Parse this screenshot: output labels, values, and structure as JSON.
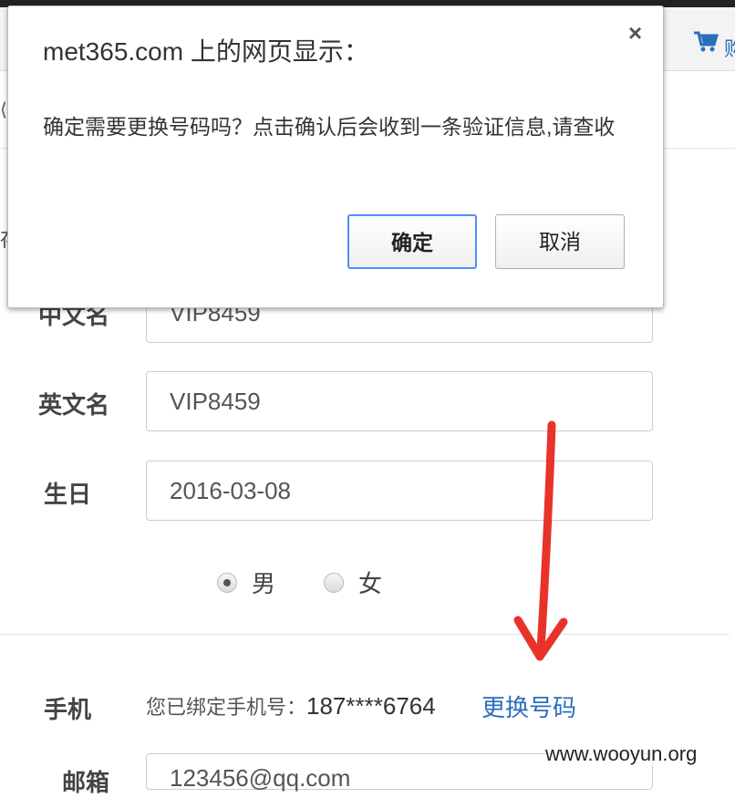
{
  "dialog": {
    "title": "met365.com 上的网页显示：",
    "message": "确定需要更换号码吗？点击确认后会收到一条验证信息,请查收",
    "close": "×",
    "ok_label": "确定",
    "cancel_label": "取消"
  },
  "header": {
    "cart_text": "购"
  },
  "form": {
    "chinese_name": {
      "label": "中文名",
      "value": "VIP8459"
    },
    "english_name": {
      "label": "英文名",
      "value": "VIP8459"
    },
    "birthday": {
      "label": "生日",
      "value": "2016-03-08"
    },
    "gender": {
      "male": "男",
      "female": "女",
      "selected": "男"
    },
    "phone": {
      "label": "手机",
      "bound_text": "您已绑定手机号：",
      "number": "187****6764",
      "change_link": "更换号码"
    },
    "email": {
      "label": "邮箱",
      "value": "123456@qq.com"
    }
  },
  "watermark": "www.wooyun.org",
  "colors": {
    "link": "#2a6ebb",
    "arrow": "#e8332a",
    "focus": "#4d90fe"
  }
}
